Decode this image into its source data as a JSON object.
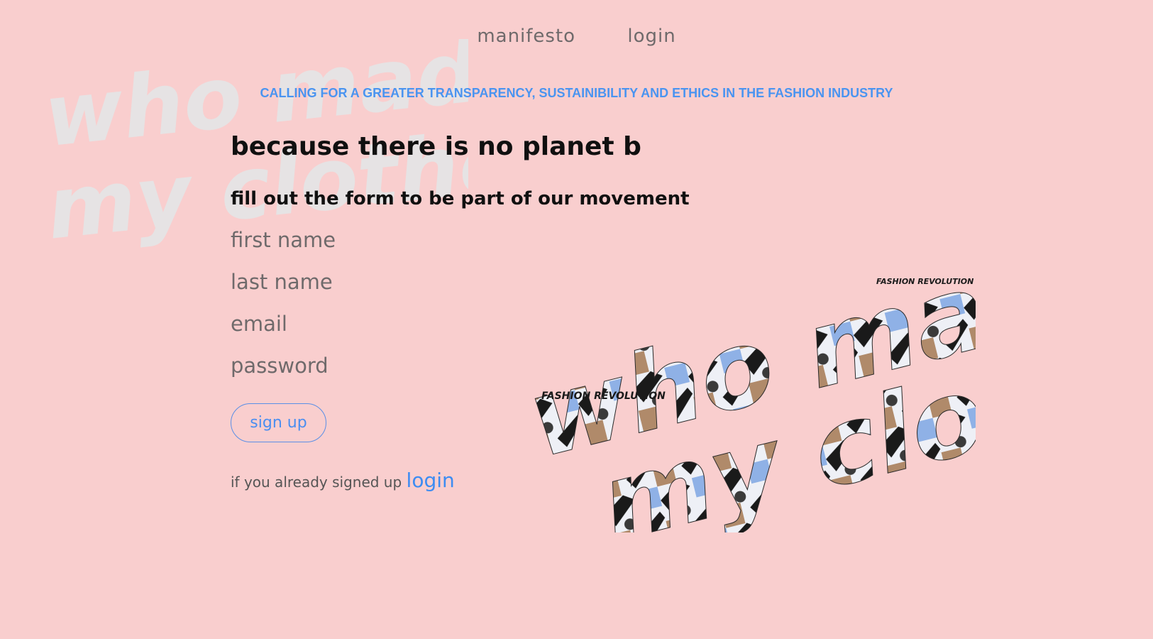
{
  "nav": {
    "manifesto": "manifesto",
    "login": "login"
  },
  "tagline": "CALLING FOR A GREATER TRANSPARENCY, SUSTAINIBILITY AND ETHICS IN THE FASHION INDUSTRY",
  "hero_title": "because there is no planet b",
  "subtitle": "fill out the form to be part of our movement",
  "form": {
    "first_name_placeholder": "first name",
    "last_name_placeholder": "last name",
    "email_placeholder": "email",
    "password_placeholder": "password",
    "signup_label": "sign up"
  },
  "login_prompt": {
    "text": "if you already signed up",
    "link": "login"
  },
  "logo": {
    "line1": "who made",
    "line2": "my clothes?",
    "sign1": "FASHION REVOLUTION",
    "sign2": "FASHION REVOLUTION"
  },
  "colors": {
    "background": "#f9cece",
    "accent": "#4a94f0",
    "muted_text": "#6f6a6b"
  }
}
